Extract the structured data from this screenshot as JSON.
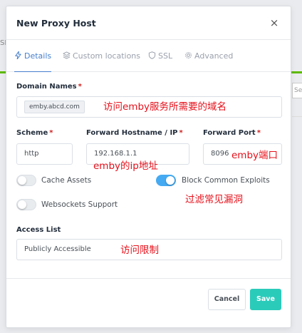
{
  "background": {
    "left_text": "SL",
    "right_text": "Sea"
  },
  "modal": {
    "title": "New Proxy Host",
    "close_glyph": "×"
  },
  "tabs": [
    {
      "label": "Details",
      "icon": "bolt-icon",
      "active": true
    },
    {
      "label": "Custom locations",
      "icon": "layers-icon",
      "active": false
    },
    {
      "label": "SSL",
      "icon": "shield-icon",
      "active": false
    },
    {
      "label": "Advanced",
      "icon": "gear-icon",
      "active": false
    }
  ],
  "domain": {
    "label": "Domain Names",
    "required_mark": "*",
    "value": "emby.abcd.com"
  },
  "scheme": {
    "label": "Scheme",
    "required_mark": "*",
    "value": "http"
  },
  "forward_host": {
    "label": "Forward Hostname / IP",
    "required_mark": "*",
    "value": "192.168.1.1"
  },
  "forward_port": {
    "label": "Forward Port",
    "required_mark": "*",
    "value": "8096"
  },
  "toggles": {
    "cache_assets": {
      "label": "Cache Assets",
      "on": false
    },
    "block_exploits": {
      "label": "Block Common Exploits",
      "on": true
    },
    "websockets": {
      "label": "Websockets Support",
      "on": false
    }
  },
  "access_list": {
    "label": "Access List",
    "value": "Publicly Accessible"
  },
  "buttons": {
    "cancel": "Cancel",
    "save": "Save"
  },
  "annotations": {
    "domain": "访问emby服务所需要的域名",
    "ip": "emby的ip地址",
    "port": "emby端口",
    "exploits": "过滤常见漏洞",
    "access": "访问限制"
  },
  "colors": {
    "accent": "#467fcf",
    "toggle_on": "#45aaf2",
    "save": "#2bcbba",
    "required": "#cd201f",
    "annotation": "#e5111b"
  }
}
